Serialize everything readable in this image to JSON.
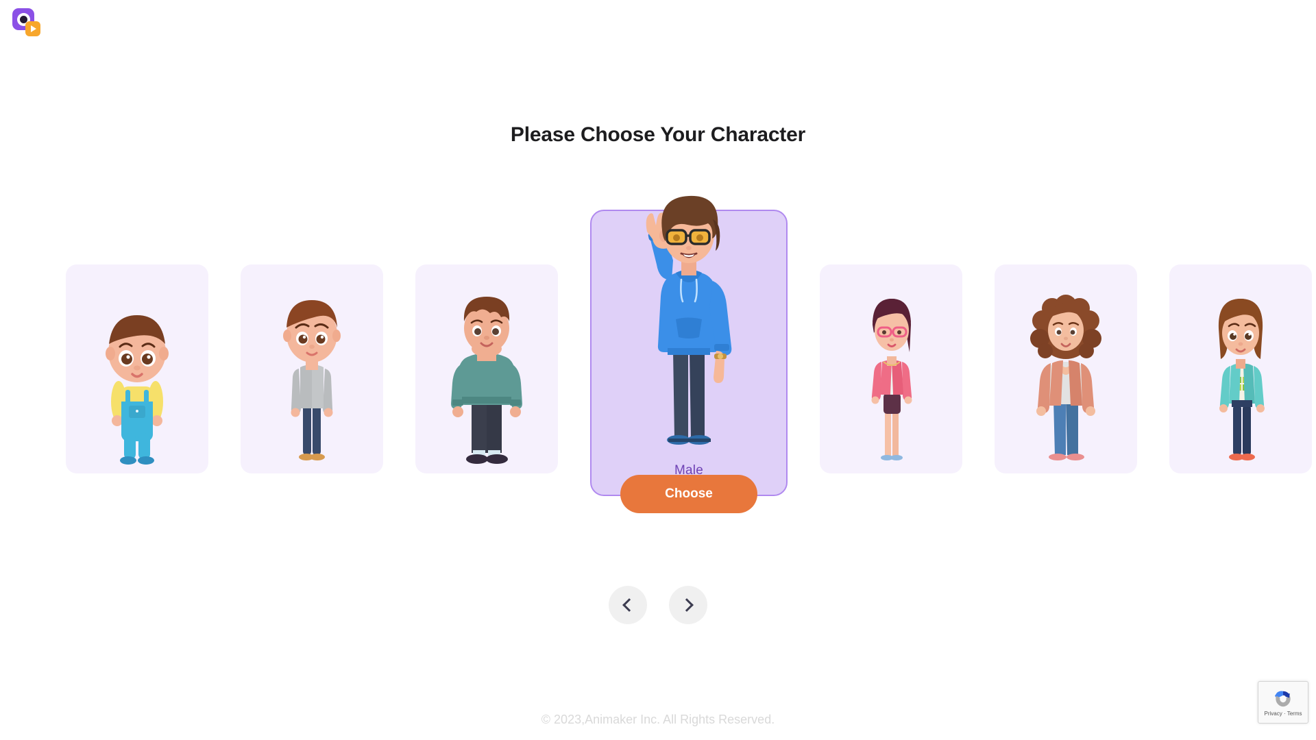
{
  "brand": {
    "logo_icon": "animaker-logo-icon",
    "logo_colors": {
      "square": "#8b50e6",
      "badge": "#f7a62c"
    }
  },
  "page": {
    "title": "Please Choose Your Character"
  },
  "carousel": {
    "selected_index": 3,
    "card_bg": "#f6f1fd",
    "selected_card_bg": "#dfd0f8",
    "selected_card_border": "#b089ef",
    "characters": [
      {
        "id": "baby",
        "name": "baby-boy-character",
        "label": "",
        "hair": "#7a3f22",
        "skin": "#f4b79c",
        "top": "#f6e06a",
        "bottom": "#3fb6dd",
        "shoes": "#2f8fc0"
      },
      {
        "id": "boy",
        "name": "boy-character",
        "label": "",
        "hair": "#8b4523",
        "skin": "#f4b79c",
        "top": "#b9bcbe",
        "bottom": "#384a6b",
        "shoes": "#d79a4e"
      },
      {
        "id": "heavy-man",
        "name": "heavy-set-man-character",
        "label": "",
        "hair": "#7a3f22",
        "skin": "#f0ae91",
        "top": "#5e9a95",
        "bottom": "#3b3f4d",
        "shoes": "#342b3e"
      },
      {
        "id": "male",
        "name": "male-character",
        "label": "Male",
        "hair": "#6b4026",
        "skin": "#f6b898",
        "top": "#3b8fe8",
        "bottom": "#3c4a60",
        "shoes": "#2d6aa8"
      },
      {
        "id": "woman-pink",
        "name": "woman-with-glasses-character",
        "label": "",
        "hair": "#5a2136",
        "skin": "#f6c0a6",
        "top": "#ef6d86",
        "bottom": "#5d3147",
        "shoes": "#8fb8e0"
      },
      {
        "id": "woman-curly",
        "name": "curly-hair-woman-character",
        "label": "",
        "hair": "#8a4a2a",
        "skin": "#f3bd9f",
        "top": "#df9078",
        "bottom": "#4d7fb5",
        "shoes": "#e98f8f"
      },
      {
        "id": "girl",
        "name": "girl-character",
        "label": "",
        "hair": "#8a4a22",
        "skin": "#f4bb9d",
        "top": "#63ccc8",
        "bottom": "#2e3f63",
        "shoes": "#ed6a4e"
      }
    ],
    "selected_label": "Male",
    "choose_button": "Choose",
    "prev_icon": "chevron-left-icon",
    "next_icon": "chevron-right-icon",
    "accent_button_color": "#e8773c",
    "selected_label_color": "#6f42b5"
  },
  "footer": {
    "copyright": "© 2023,Animaker Inc. All Rights Reserved."
  },
  "recaptcha": {
    "icon": "recaptcha-icon",
    "text": "Privacy · Terms"
  }
}
